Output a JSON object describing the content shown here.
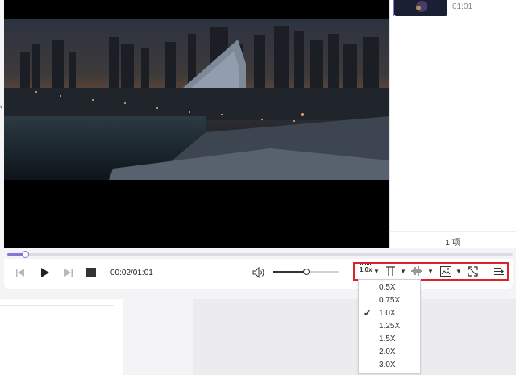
{
  "playlist": {
    "item_duration": "01:01",
    "count_label": "1 项"
  },
  "player": {
    "time_display": "00:02/01:01",
    "progress_fraction": 0.035,
    "volume_fraction": 0.5
  },
  "toolbar": {
    "speed_label": "1.0x"
  },
  "speed_menu": {
    "options": [
      "0.5X",
      "0.75X",
      "1.0X",
      "1.25X",
      "1.5X",
      "2.0X",
      "3.0X"
    ],
    "selected": "1.0X",
    "check_glyph": "✔"
  },
  "colors": {
    "accent": "#8b74d9",
    "highlight_border": "#d9232d"
  }
}
